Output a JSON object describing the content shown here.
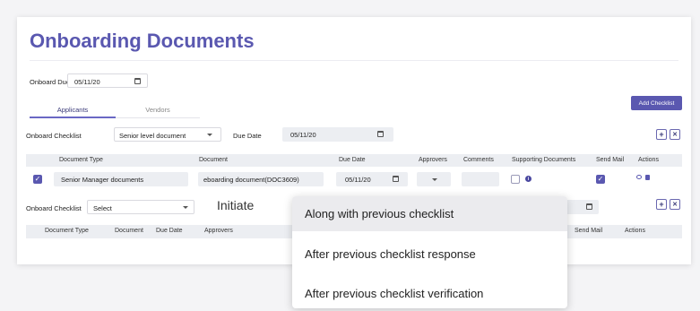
{
  "page": {
    "title": "Onboarding Documents"
  },
  "onboard": {
    "label": "Onboard Due",
    "value": "05/11/20"
  },
  "tabs": [
    {
      "label": "Applicants"
    },
    {
      "label": "Vendors"
    }
  ],
  "add_checklist_label": "Add Checklist",
  "checklist1": {
    "label": "Onboard Checklist",
    "select_value": "Senior level document",
    "due_label": "Due Date",
    "due_value": "05/11/20",
    "headers": {
      "document_type": "Document Type",
      "document": "Document",
      "due_date": "Due Date",
      "approvers": "Approvers",
      "comments": "Comments",
      "supporting": "Supporting Documents",
      "send_mail": "Send Mail",
      "actions": "Actions"
    },
    "row": {
      "document_type": "Senior Manager documents",
      "document": "eboarding document(DOC3609)",
      "due_date": "05/11/20"
    }
  },
  "checklist2": {
    "label": "Onboard Checklist",
    "select_value": "Select",
    "initiate_label": "Initiate",
    "headers": {
      "document_type": "Document Type",
      "document": "Document",
      "due_date": "Due Date",
      "approvers": "Approvers",
      "send_mail": "Send Mail",
      "actions": "Actions"
    }
  },
  "initiate_menu": {
    "options": [
      {
        "label": "Along with previous checklist"
      },
      {
        "label": "After previous checklist response"
      },
      {
        "label": "After previous checklist verification"
      }
    ],
    "selected": "Along with previous checklist"
  },
  "colors": {
    "brand": "#5a58b0",
    "header_band": "#eceef2"
  }
}
